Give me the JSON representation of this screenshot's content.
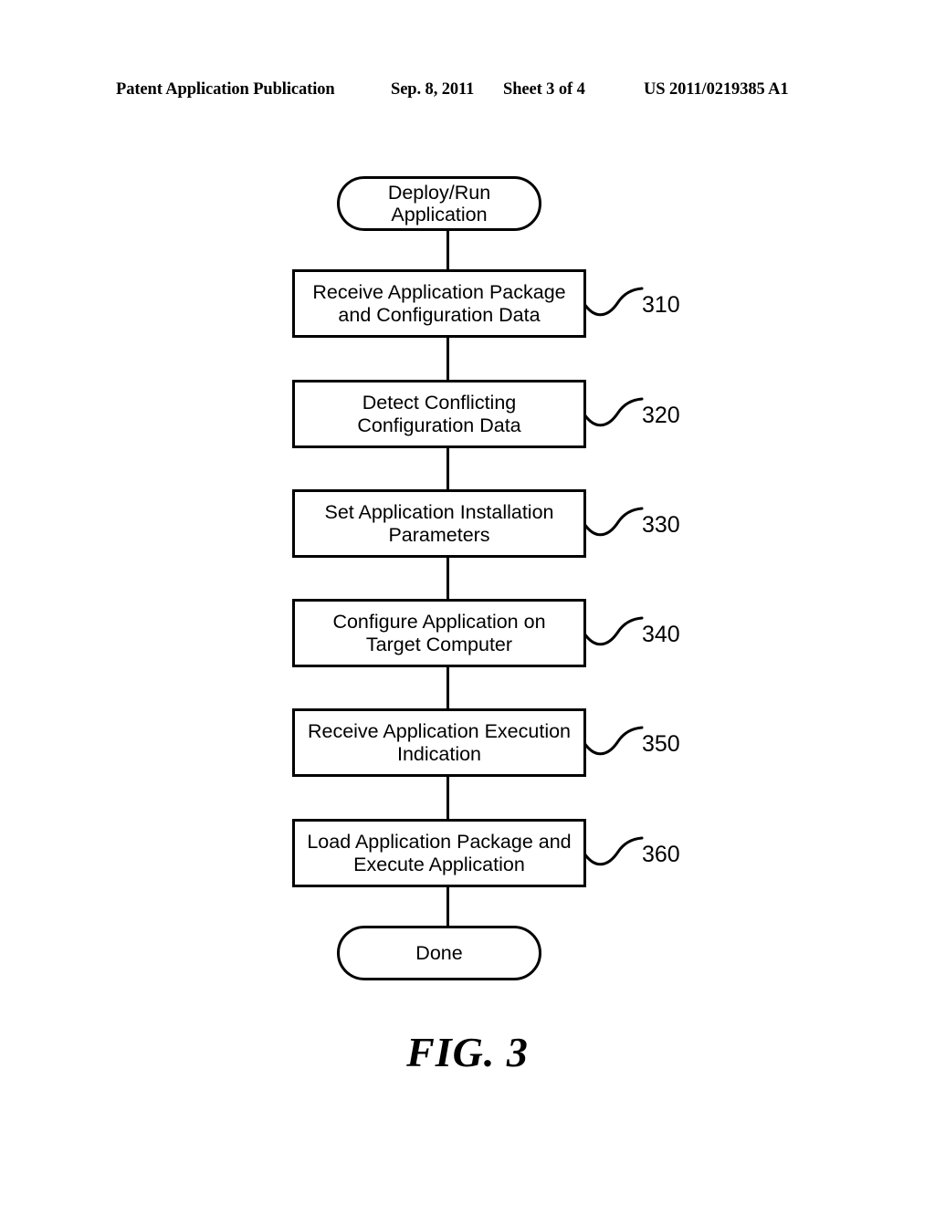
{
  "header": {
    "publication": "Patent Application Publication",
    "date": "Sep. 8, 2011",
    "sheet": "Sheet 3 of 4",
    "document_number": "US 2011/0219385 A1"
  },
  "figure": {
    "caption": "FIG. 3"
  },
  "flowchart": {
    "start": {
      "label": "Deploy/Run\nApplication",
      "shape": "terminator"
    },
    "steps": [
      {
        "label": "Receive Application Package\nand Configuration Data",
        "ref": "310",
        "shape": "process"
      },
      {
        "label": "Detect Conflicting\nConfiguration Data",
        "ref": "320",
        "shape": "process"
      },
      {
        "label": "Set Application Installation\nParameters",
        "ref": "330",
        "shape": "process"
      },
      {
        "label": "Configure Application on\nTarget Computer",
        "ref": "340",
        "shape": "process"
      },
      {
        "label": "Receive Application Execution\nIndication",
        "ref": "350",
        "shape": "process"
      },
      {
        "label": "Load Application Package and\nExecute Application",
        "ref": "360",
        "shape": "process"
      }
    ],
    "end": {
      "label": "Done",
      "shape": "terminator"
    },
    "colors": {
      "stroke": "#000000",
      "fill": "#ffffff",
      "text": "#000000"
    }
  }
}
